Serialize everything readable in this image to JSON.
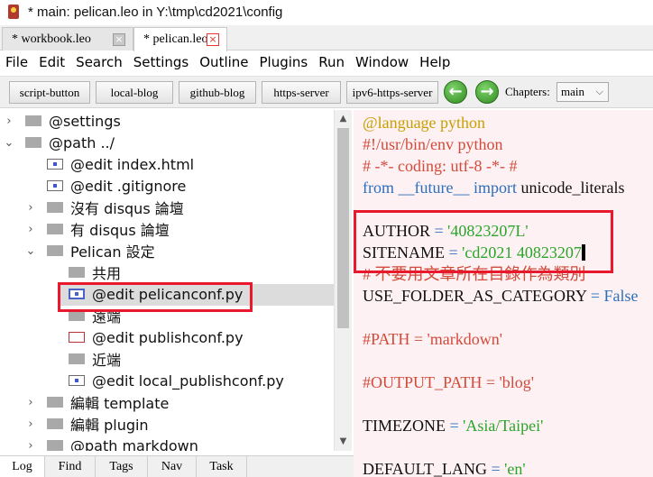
{
  "window": {
    "title": "* main: pelican.leo in Y:\\tmp\\cd2021\\config"
  },
  "tabs": [
    {
      "label": "* workbook.leo",
      "close": "×"
    },
    {
      "label": "* pelican.leo",
      "close": "×"
    }
  ],
  "menu": [
    "File",
    "Edit",
    "Search",
    "Settings",
    "Outline",
    "Plugins",
    "Run",
    "Window",
    "Help"
  ],
  "buttons": [
    "script-button",
    "local-blog",
    "github-blog",
    "https-server",
    "ipv6-https-server"
  ],
  "nav": {
    "back_glyph": "←",
    "forward_glyph": "→",
    "chapters_label": "Chapters:",
    "chapters_value": "main",
    "chapters_caret": "⌵"
  },
  "outline": {
    "nodes": [
      {
        "twisty": "›",
        "icon": "plain",
        "label": "@settings"
      },
      {
        "twisty": "⌄",
        "icon": "plain",
        "label": "@path ../"
      },
      {
        "twisty": "",
        "icon": "marked",
        "label": "@edit index.html"
      },
      {
        "twisty": "",
        "icon": "marked",
        "label": "@edit .gitignore"
      },
      {
        "twisty": "›",
        "icon": "plain",
        "label": "沒有 disqus 論壇"
      },
      {
        "twisty": "›",
        "icon": "plain",
        "label": "有 disqus 論壇"
      },
      {
        "twisty": "⌄",
        "icon": "plain",
        "label": "Pelican 設定"
      },
      {
        "twisty": "",
        "icon": "plain",
        "label": "共用"
      },
      {
        "twisty": "",
        "icon": "bluebox",
        "label": "@edit pelicanconf.py"
      },
      {
        "twisty": "",
        "icon": "plain",
        "label": "遠端"
      },
      {
        "twisty": "",
        "icon": "markedred",
        "label": "@edit publishconf.py"
      },
      {
        "twisty": "",
        "icon": "plain",
        "label": "近端"
      },
      {
        "twisty": "",
        "icon": "marked",
        "label": "@edit local_publishconf.py"
      },
      {
        "twisty": "›",
        "icon": "plain",
        "label": "編輯 template"
      },
      {
        "twisty": "›",
        "icon": "plain",
        "label": "編輯 plugin"
      },
      {
        "twisty": "›",
        "icon": "plain",
        "label": "@path markdown"
      }
    ]
  },
  "body": {
    "lines": [
      [
        {
          "t": "@language python",
          "c": "dir"
        }
      ],
      [
        {
          "t": "#!/usr/bin/env python",
          "c": "cmt"
        }
      ],
      [
        {
          "t": "# -*- coding: utf-8 -*- #",
          "c": "cmt"
        }
      ],
      [
        {
          "t": "from ",
          "c": "kw"
        },
        {
          "t": "__future__",
          "c": "kw"
        },
        {
          "t": " import ",
          "c": "kw"
        },
        {
          "t": "unicode_literals",
          "c": "txt"
        }
      ],
      [],
      [
        {
          "t": "AUTHOR ",
          "c": "txt"
        },
        {
          "t": "= ",
          "c": "op"
        },
        {
          "t": "'40823207L'",
          "c": "str"
        }
      ],
      [
        {
          "t": "SITENAME ",
          "c": "txt"
        },
        {
          "t": "= ",
          "c": "op"
        },
        {
          "t": "'cd2021 40823207",
          "c": "str"
        }
      ],
      [
        {
          "t": "# 不要用文章所在目錄作為類別",
          "c": "cmt"
        }
      ],
      [
        {
          "t": "USE_FOLDER_AS_CATEGORY ",
          "c": "txt"
        },
        {
          "t": "= ",
          "c": "op"
        },
        {
          "t": "False",
          "c": "kw"
        }
      ],
      [],
      [
        {
          "t": "#PATH = 'markdown'",
          "c": "cmt"
        }
      ],
      [],
      [
        {
          "t": "#OUTPUT_PATH = 'blog'",
          "c": "cmt"
        }
      ],
      [],
      [
        {
          "t": "TIMEZONE ",
          "c": "txt"
        },
        {
          "t": "= ",
          "c": "op"
        },
        {
          "t": "'Asia/Taipei'",
          "c": "str"
        }
      ],
      [],
      [
        {
          "t": "DEFAULT_LANG ",
          "c": "txt"
        },
        {
          "t": "= ",
          "c": "op"
        },
        {
          "t": "'en'",
          "c": "str"
        }
      ]
    ]
  },
  "log_tabs": [
    "Log",
    "Find",
    "Tags",
    "Nav",
    "Task"
  ]
}
